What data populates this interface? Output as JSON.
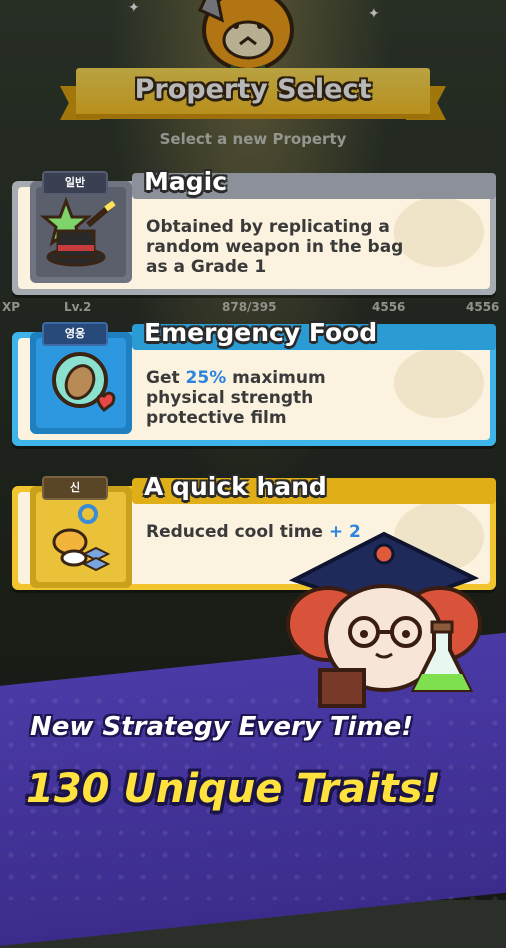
{
  "header": {
    "title": "Property Select",
    "subtitle": "Select a new Property"
  },
  "hud": {
    "xp": "XP",
    "level": "Lv.2",
    "hp": "878/395",
    "attack": "4556",
    "defense": "4556"
  },
  "cards": [
    {
      "grade": "일반",
      "title": "Magic",
      "desc": "Obtained by replicating a random weapon in the bag as a Grade 1",
      "icon": "magic-hat-wand-icon"
    },
    {
      "grade": "영웅",
      "title": "Emergency Food",
      "desc_prefix": "Get ",
      "desc_highlight": "25%",
      "desc_suffix": " maximum physical strength protective film",
      "icon": "seed-orb-heart-icon"
    },
    {
      "grade": "신",
      "title": "A quick hand",
      "desc_prefix": "Reduced cool time ",
      "desc_highlight": "+ 2",
      "icon": "quick-hand-icon"
    }
  ],
  "banner": {
    "line1": "New Strategy Every Time!",
    "line2": "130 Unique Traits!"
  },
  "colors": {
    "accent_yellow": "#ffc728",
    "card_common": "#a7acb3",
    "card_hero": "#3fb4ea",
    "card_legend": "#f2c52f",
    "highlight_blue": "#2a84e0",
    "banner_purple": "#3b2c8c"
  }
}
